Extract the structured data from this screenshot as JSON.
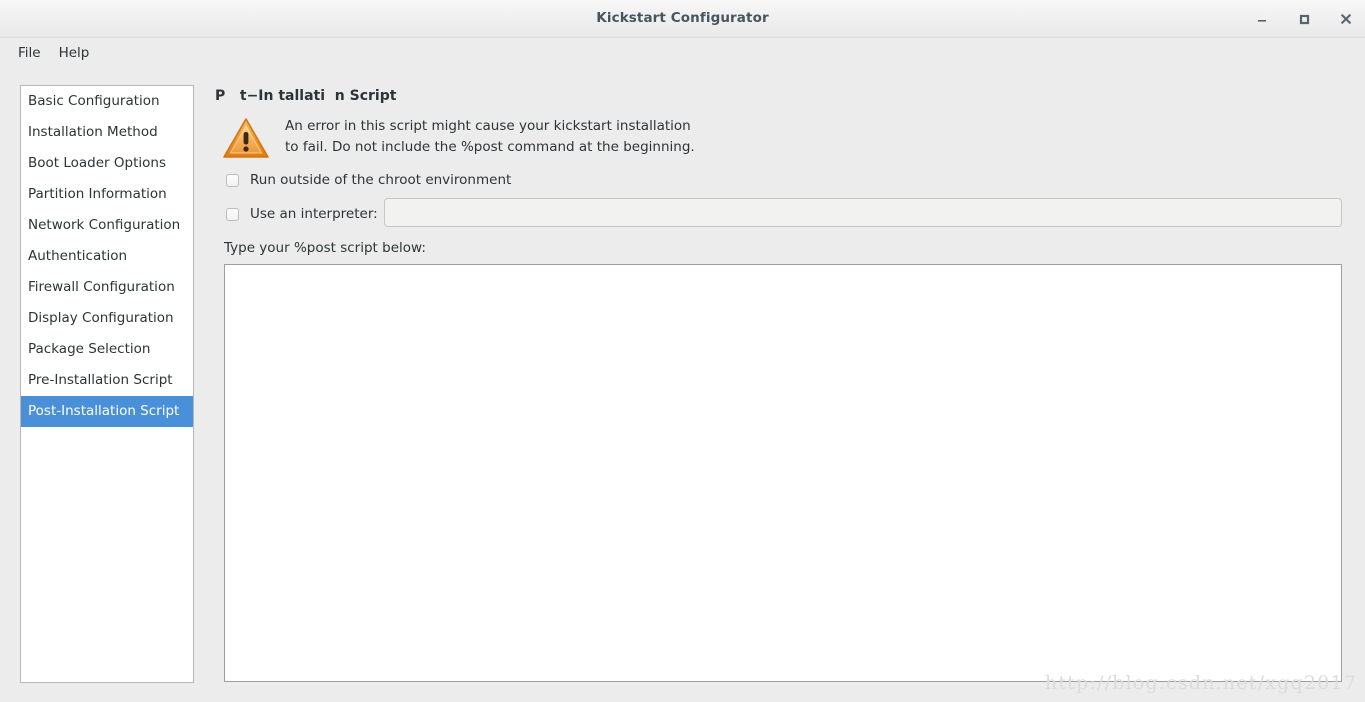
{
  "window": {
    "title": "Kickstart Configurator",
    "controls": [
      {
        "name": "minimize",
        "glyph": "minimize-icon"
      },
      {
        "name": "maximize",
        "glyph": "maximize-icon"
      },
      {
        "name": "close",
        "glyph": "close-icon"
      }
    ]
  },
  "menubar": {
    "items": [
      {
        "label": "File"
      },
      {
        "label": "Help"
      }
    ]
  },
  "sidebar": {
    "items": [
      {
        "label": "Basic Configuration",
        "selected": false
      },
      {
        "label": "Installation Method",
        "selected": false
      },
      {
        "label": "Boot Loader Options",
        "selected": false
      },
      {
        "label": "Partition Information",
        "selected": false
      },
      {
        "label": "Network Configuration",
        "selected": false
      },
      {
        "label": "Authentication",
        "selected": false
      },
      {
        "label": "Firewall Configuration",
        "selected": false
      },
      {
        "label": "Display Configuration",
        "selected": false
      },
      {
        "label": "Package Selection",
        "selected": false
      },
      {
        "label": "Pre-Installation Script",
        "selected": false
      },
      {
        "label": "Post-Installation Script",
        "selected": true
      }
    ],
    "selected_index": 10,
    "selected_bg": "#4a90d9",
    "selected_fg": "#ffffff"
  },
  "main": {
    "page_title": "P   t−In tallati  n Script",
    "warning": {
      "icon": "warning-triangle-icon",
      "icon_color": "#f0932b",
      "text": "An  error  in  this  script  might  cause  your  kickstart  installation\nto fail. Do not include the %post command at the beginning."
    },
    "chroot_checkbox": {
      "label": "Run outside of the chroot environment",
      "checked": false
    },
    "interpreter_checkbox": {
      "label": "Use an interpreter:",
      "checked": false
    },
    "interpreter_input": {
      "value": "",
      "placeholder": "",
      "enabled": false
    },
    "script_label": "Type your %post script below:",
    "script_textarea": {
      "value": "",
      "placeholder": ""
    }
  },
  "watermark": {
    "text": "http://blog.csdn.net/xgq2017"
  }
}
